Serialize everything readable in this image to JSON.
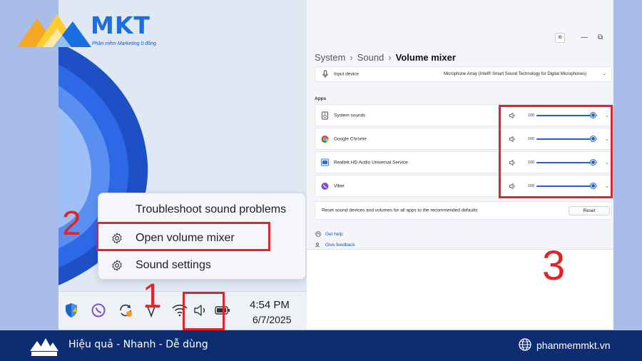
{
  "brand": {
    "name": "MKT",
    "tagline": "Phần mềm Marketing 0 đồng"
  },
  "popup_menu": {
    "items": [
      {
        "label": "Troubleshoot sound problems",
        "icon": "none"
      },
      {
        "label": "Open volume mixer",
        "icon": "gear-icon"
      },
      {
        "label": "Sound settings",
        "icon": "gear-icon"
      }
    ]
  },
  "taskbar": {
    "icons": [
      "windows-security-icon",
      "viber-icon",
      "sync-warning-icon",
      "vpn-icon",
      "wifi-icon",
      "speaker-icon",
      "battery-icon"
    ],
    "time": "4:54 PM",
    "date": "6/7/2025"
  },
  "steps": {
    "one": "1",
    "two": "2",
    "three": "3"
  },
  "settings": {
    "window_badge": "IB",
    "breadcrumb": [
      "System",
      "Sound",
      "Volume mixer"
    ],
    "input_device": {
      "label": "Input device",
      "value": "Microphone Array (Intel® Smart Sound Technology for Digital Microphones)"
    },
    "apps_heading": "Apps",
    "apps": [
      {
        "name": "System sounds",
        "volume": 100,
        "icon": "system-sounds-icon"
      },
      {
        "name": "Google Chrome",
        "volume": 100,
        "icon": "chrome-icon"
      },
      {
        "name": "Realtek HD Audio Universal Service",
        "volume": 100,
        "icon": "realtek-icon"
      },
      {
        "name": "Viber",
        "volume": 100,
        "icon": "viber-icon"
      }
    ],
    "reset_text": "Reset sound devices and volumes for all apps to the recommended defaults",
    "reset_button": "Reset",
    "help_links": [
      "Get help",
      "Give feedback"
    ]
  },
  "footer": {
    "slogan": "Hiệu quả - Nhanh - Dễ dùng",
    "website": "phanmemmkt.vn"
  },
  "colors": {
    "accent_red": "#e0242a",
    "slider_blue": "#1d63c9",
    "footer_bg": "#0e2c72",
    "page_bg": "#a9bde8"
  }
}
